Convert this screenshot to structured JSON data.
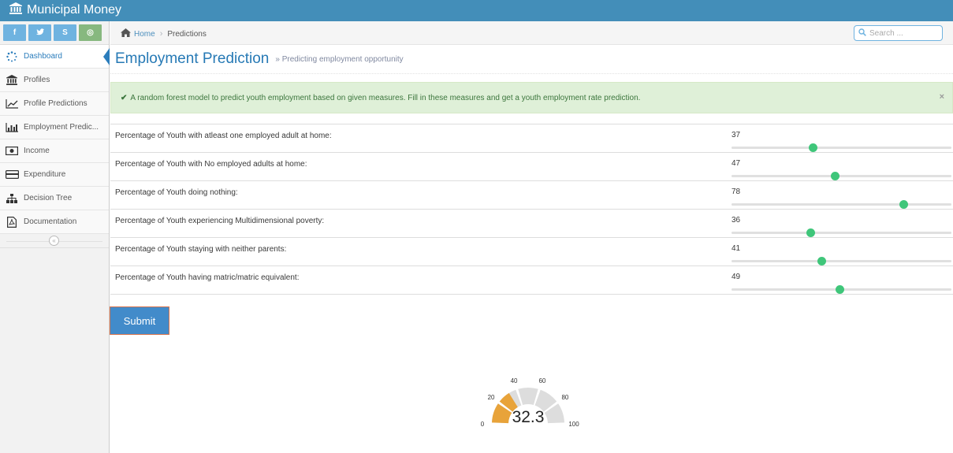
{
  "app": {
    "title": "Municipal Money"
  },
  "shortcuts": [
    {
      "icon": "facebook-icon",
      "label": "f",
      "color": "#6fb3e0"
    },
    {
      "icon": "twitter-icon",
      "label": "✓",
      "color": "#6fb3e0"
    },
    {
      "icon": "skype-icon",
      "label": "S",
      "color": "#6fb3e0"
    },
    {
      "icon": "whatsapp-icon",
      "label": "◎",
      "color": "#87b87f"
    }
  ],
  "sidebar": {
    "items": [
      {
        "label": "Dashboard",
        "icon": "spinner-icon",
        "active": true
      },
      {
        "label": "Profiles",
        "icon": "bank-icon"
      },
      {
        "label": "Profile Predictions",
        "icon": "line-chart-icon"
      },
      {
        "label": "Employment Predic...",
        "icon": "bar-chart-icon"
      },
      {
        "label": "Income",
        "icon": "money-icon"
      },
      {
        "label": "Expenditure",
        "icon": "credit-card-icon"
      },
      {
        "label": "Decision Tree",
        "icon": "sitemap-icon"
      },
      {
        "label": "Documentation",
        "icon": "pdf-file-icon"
      }
    ],
    "collapse_glyph": "«"
  },
  "breadcrumb": {
    "home": "Home",
    "current": "Predictions"
  },
  "search": {
    "placeholder": "Search ..."
  },
  "page": {
    "title": "Employment Prediction",
    "subtitle": "» Predicting employment opportunity"
  },
  "alert": {
    "text": "A random forest model to predict youth employment based on given measures. Fill in these measures and get a youth employment rate prediction.",
    "close": "×"
  },
  "sliders": [
    {
      "label": "Percentage of Youth with atleast one employed adult at home:",
      "value": "37",
      "level": 0.37
    },
    {
      "label": "Percentage of Youth with No employed adults at home:",
      "value": "47",
      "level": 0.47
    },
    {
      "label": "Percentage of Youth doing nothing:",
      "value": "78",
      "level": 0.78
    },
    {
      "label": "Percentage of Youth experiencing Multidimensional poverty:",
      "value": "36",
      "level": 0.36
    },
    {
      "label": "Percentage of Youth staying with neither parents:",
      "value": "41",
      "level": 0.41
    },
    {
      "label": "Percentage of Youth having matric/matric equivalent:",
      "value": "49",
      "level": 0.49
    }
  ],
  "submit": {
    "label": "Submit"
  },
  "gauge": {
    "value": "32.3",
    "min": 0,
    "max": 100,
    "ticks": [
      "0",
      "20",
      "40",
      "60",
      "80",
      "100"
    ],
    "fill_color": "#e8a33a",
    "track_color": "#dddddd"
  }
}
